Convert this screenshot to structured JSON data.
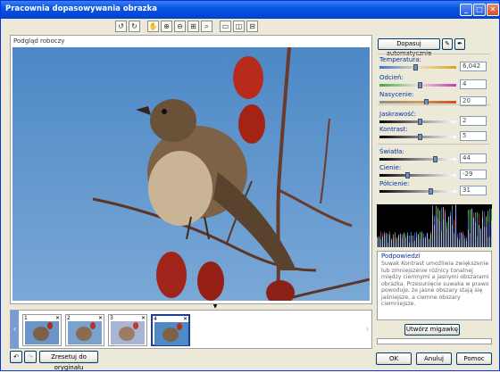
{
  "window": {
    "title": "Pracownia dopasowywania obrazka",
    "controls": [
      "minimize",
      "maximize",
      "close"
    ]
  },
  "toolbar": {
    "tools": [
      "rotate-left-icon",
      "rotate-right-icon",
      "hand-icon",
      "zoom-in-icon",
      "zoom-out-icon",
      "fit-icon",
      "actual-size-icon",
      "single-view-icon",
      "split-vertical-icon",
      "split-horizontal-icon"
    ]
  },
  "preview": {
    "label": "Podgląd roboczy"
  },
  "filmstrip": {
    "thumbs": [
      {
        "num": "1",
        "selected": false
      },
      {
        "num": "2",
        "selected": false
      },
      {
        "num": "3",
        "selected": false
      },
      {
        "num": "4",
        "selected": true
      }
    ]
  },
  "bottom": {
    "reset_label": "Zresetuj do oryginału"
  },
  "panel": {
    "auto_fit_label": "Dopasuj automatycznie",
    "sliders": [
      {
        "label": "Temperatura:",
        "value": "6,042",
        "level": 0.47,
        "track": "temp"
      },
      {
        "label": "Odcień:",
        "value": "4",
        "level": 0.52,
        "track": "tint"
      },
      {
        "label": "Nasycenie:",
        "value": "20",
        "level": 0.6,
        "track": "sat"
      },
      {
        "label": "Jaskrawość:",
        "value": "2",
        "level": 0.52,
        "track": "gray"
      },
      {
        "label": "Kontrast:",
        "value": "5",
        "level": 0.52,
        "track": "gray"
      },
      {
        "label": "Światła:",
        "value": "44",
        "level": 0.72,
        "track": "gray"
      },
      {
        "label": "Cienie:",
        "value": "-29",
        "level": 0.36,
        "track": "gray"
      },
      {
        "label": "Półcienie:",
        "value": "31",
        "level": 0.66,
        "track": "gray"
      }
    ]
  },
  "hint": {
    "title": "Podpowiedzi",
    "text": "Suwak Kontrast umożliwia zwiększenie lub zmniejszenie różnicy tonalnej między ciemnymi a jasnymi obszarami obrazka. Przesunięcie suwaka w prawo powoduje, że jasne obszary stają się jaśniejsze, a ciemne obszary ciemniejsze."
  },
  "snapshot_label": "Utwórz migawkę",
  "dialog": {
    "ok_label": "OK",
    "cancel_label": "Anuluj",
    "help_label": "Pomoc"
  }
}
